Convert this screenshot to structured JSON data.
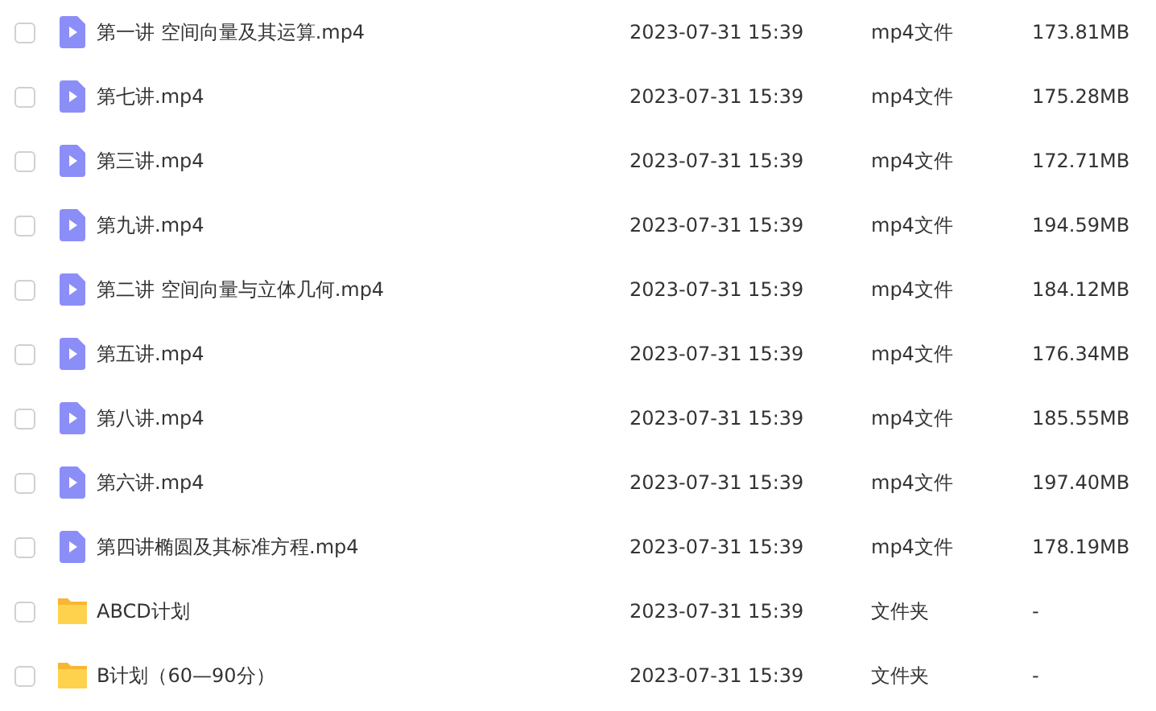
{
  "files": [
    {
      "kind": "video",
      "checked": false,
      "name": "第一讲 空间向量及其运算.mp4",
      "date": "2023-07-31 15:39",
      "type": "mp4文件",
      "size": "173.81MB"
    },
    {
      "kind": "video",
      "checked": false,
      "name": "第七讲.mp4",
      "date": "2023-07-31 15:39",
      "type": "mp4文件",
      "size": "175.28MB"
    },
    {
      "kind": "video",
      "checked": false,
      "name": "第三讲.mp4",
      "date": "2023-07-31 15:39",
      "type": "mp4文件",
      "size": "172.71MB"
    },
    {
      "kind": "video",
      "checked": false,
      "name": "第九讲.mp4",
      "date": "2023-07-31 15:39",
      "type": "mp4文件",
      "size": "194.59MB"
    },
    {
      "kind": "video",
      "checked": false,
      "name": "第二讲 空间向量与立体几何.mp4",
      "date": "2023-07-31 15:39",
      "type": "mp4文件",
      "size": "184.12MB"
    },
    {
      "kind": "video",
      "checked": false,
      "name": "第五讲.mp4",
      "date": "2023-07-31 15:39",
      "type": "mp4文件",
      "size": "176.34MB"
    },
    {
      "kind": "video",
      "checked": false,
      "name": "第八讲.mp4",
      "date": "2023-07-31 15:39",
      "type": "mp4文件",
      "size": "185.55MB"
    },
    {
      "kind": "video",
      "checked": false,
      "name": "第六讲.mp4",
      "date": "2023-07-31 15:39",
      "type": "mp4文件",
      "size": "197.40MB"
    },
    {
      "kind": "video",
      "checked": false,
      "name": "第四讲椭圆及其标准方程.mp4",
      "date": "2023-07-31 15:39",
      "type": "mp4文件",
      "size": "178.19MB"
    },
    {
      "kind": "folder",
      "checked": false,
      "name": "ABCD计划",
      "date": "2023-07-31 15:39",
      "type": "文件夹",
      "size": "-"
    },
    {
      "kind": "folder",
      "checked": false,
      "name": "B计划（60—90分）",
      "date": "2023-07-31 15:39",
      "type": "文件夹",
      "size": "-"
    }
  ]
}
